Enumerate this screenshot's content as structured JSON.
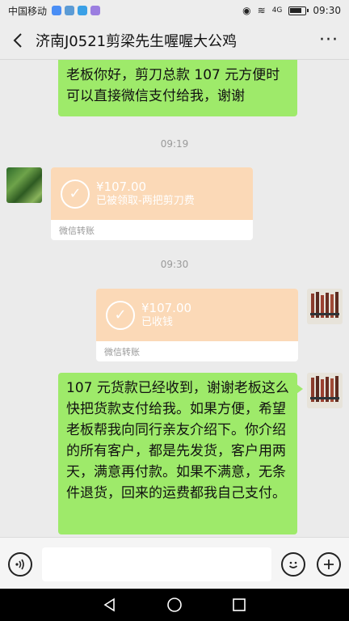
{
  "status": {
    "carrier": "中国移动",
    "network": "4G",
    "time": "09:30"
  },
  "header": {
    "title": "济南J0521剪梁先生喔喔大公鸡",
    "back_glyph": "‹",
    "more_glyph": "···"
  },
  "messages": {
    "m1_text": "老板你好，剪刀总款 107 元方便时可以直接微信支付给我，谢谢",
    "time1": "09:19",
    "transfer1": {
      "amount": "¥107.00",
      "note": "已被领取-两把剪刀费",
      "footer": "微信转账"
    },
    "time2": "09:30",
    "transfer2": {
      "amount": "¥107.00",
      "note": "已收钱",
      "footer": "微信转账"
    },
    "m2_text": "107 元货款已经收到，谢谢老板这么快把货款支付给我。如果方便，希望老板帮我向同行亲友介绍下。你介绍的所有客户，都是先发货，客户用两天，满意再付款。如果不满意，无条件退货，回来的运费都我自己支付。"
  },
  "input": {
    "voice_glyph": "🔊",
    "emoji_glyph": "☺",
    "plus_glyph": "+"
  },
  "nav": {
    "back_glyph": "◁",
    "home_glyph": "○",
    "recent_glyph": "□"
  },
  "colors": {
    "bubble_green": "#9eea6a",
    "transfer_orange": "#fbd9b7",
    "background": "#ebebeb"
  }
}
